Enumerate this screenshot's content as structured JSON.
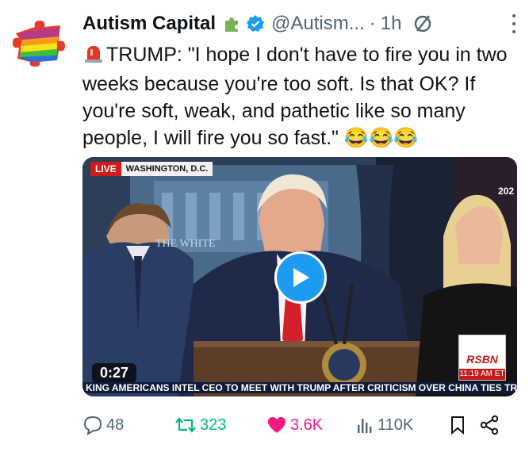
{
  "tweet": {
    "display_name": "Autism Capital",
    "handle": "@Autism...",
    "separator": "·",
    "time": "1h",
    "text": "TRUMP: \"I hope I don't have to fire you in two weeks because you're too soft. Is that OK? If you're soft, weak, and pathetic like so many people, I will fire you so fast.\" 😂😂😂"
  },
  "video": {
    "live_label": "LIVE",
    "location": "WASHINGTON, D.C.",
    "year_fragment": "202",
    "duration": "0:27",
    "network": "RSBN",
    "network_time": "11:19 AM ET",
    "ticker": "KING AMERICANS   INTEL CEO TO MEET WITH TRUMP AFTER CRITICISM OVER CHINA TIES   TRU",
    "backdrop_text": "THE WHITE"
  },
  "actions": {
    "replies": "48",
    "reposts": "323",
    "likes": "3.6K",
    "views": "110K"
  },
  "colors": {
    "accent": "#1d9bf0",
    "repost": "#00ba7c",
    "like": "#f91880",
    "muted": "#536471"
  }
}
